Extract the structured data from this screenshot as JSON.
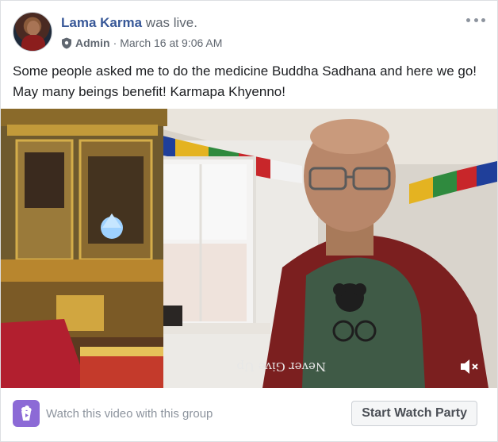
{
  "post": {
    "author": "Lama Karma",
    "action": "was live.",
    "role": "Admin",
    "separator": "·",
    "timestamp": "March 16 at 9:06 AM",
    "text": "Some people asked me to do the medicine Buddha Sadhana and here we go! May many beings benefit! Karmapa Khyenno!"
  },
  "video": {
    "shirt_text": "Never Give Up",
    "muted": true
  },
  "footer": {
    "watch_group_text": "Watch this video with this group",
    "watch_party_button": "Start Watch Party"
  },
  "icons": {
    "avatar": "profile-avatar",
    "role_badge": "shield-icon",
    "more_options": "more-options-icon",
    "mute": "speaker-muted-icon",
    "watch_party": "watch-party-icon"
  },
  "colors": {
    "author_link": "#385898",
    "secondary_text": "#606770",
    "watch_party_accent": "#8c6ad6"
  }
}
